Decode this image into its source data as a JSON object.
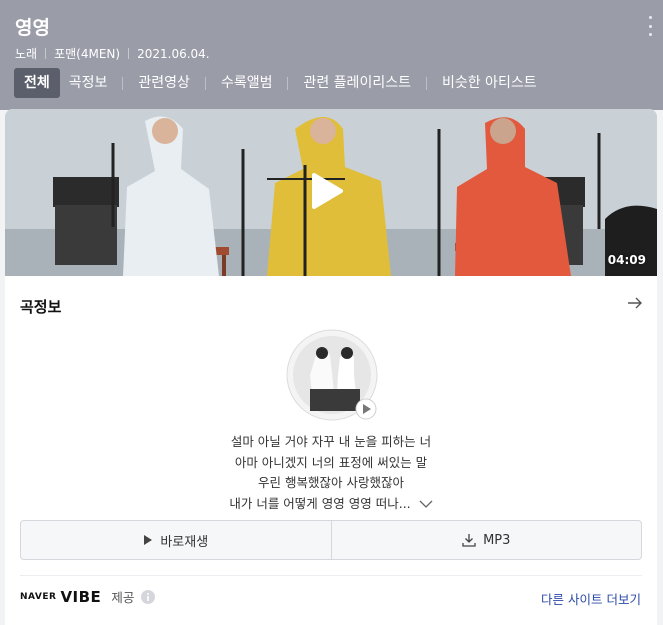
{
  "header": {
    "title": "영영",
    "meta": [
      "노래",
      "포맨(4MEN)",
      "2021.06.04."
    ],
    "tabs": [
      {
        "label": "전체",
        "active": true
      },
      {
        "label": "곡정보"
      },
      {
        "label": "관련영상"
      },
      {
        "label": "수록앨범"
      },
      {
        "label": "관련 플레이리스트"
      },
      {
        "label": "비슷한 아티스트"
      }
    ]
  },
  "video": {
    "duration": "04:09",
    "icon": "play-icon"
  },
  "song_info": {
    "heading": "곡정보",
    "lyrics": [
      "설마 아닐 거야 자꾸 내 눈을 피하는 너",
      "아마 아니겠지 너의 표정에 써있는 말",
      "우린 행복했잖아 사랑했잖아",
      "내가 너를 어떻게 영영 영영 떠나..."
    ]
  },
  "actions": {
    "play_label": "바로재생",
    "mp3_label": "MP3"
  },
  "footer": {
    "logo_naver": "NAVER",
    "logo_vibe": "VIBE",
    "provide": "제공",
    "more_sites": "다른 사이트 더보기"
  },
  "colors": {
    "header_bg": "#9a9ca8",
    "active_tab": "#5b5e6b",
    "link": "#2c4aa8"
  }
}
